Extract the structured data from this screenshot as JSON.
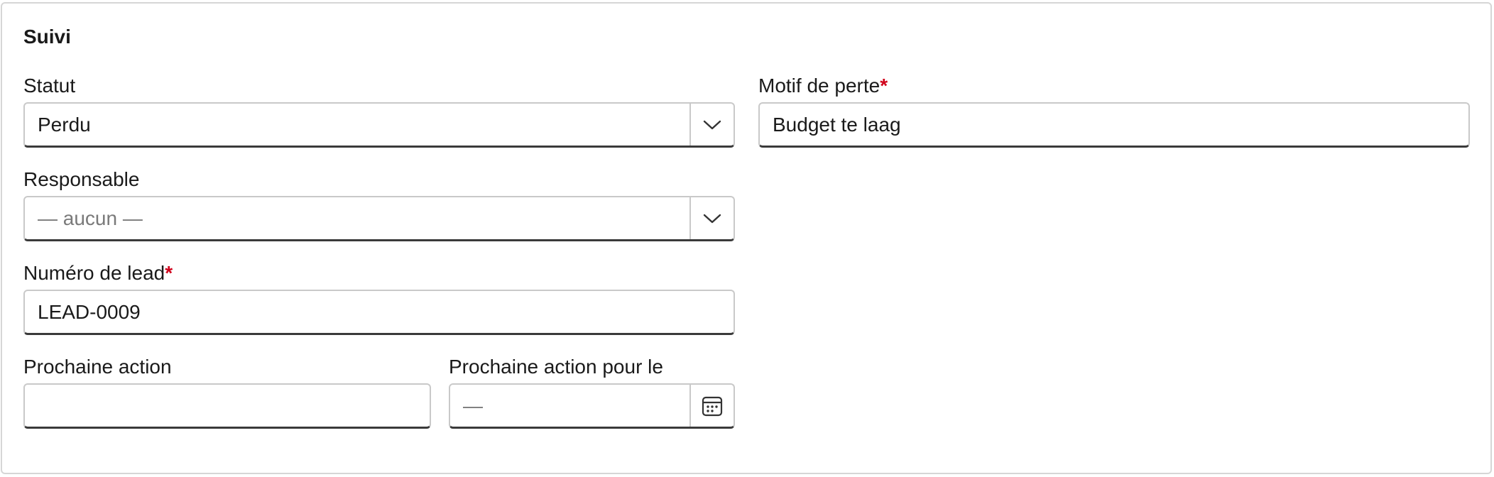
{
  "section": {
    "title": "Suivi"
  },
  "fields": {
    "statut": {
      "label": "Statut",
      "value": "Perdu",
      "icon": "chevron-down-icon"
    },
    "motif_de_perte": {
      "label": "Motif de perte",
      "required_mark": "*",
      "value": "Budget te laag"
    },
    "responsable": {
      "label": "Responsable",
      "placeholder": "— aucun —",
      "icon": "chevron-down-icon"
    },
    "numero_de_lead": {
      "label": "Numéro de lead",
      "required_mark": "*",
      "value": "LEAD-0009"
    },
    "prochaine_action": {
      "label": "Prochaine action",
      "value": ""
    },
    "prochaine_action_pour_le": {
      "label": "Prochaine action pour le",
      "placeholder": "—",
      "icon": "calendar-icon"
    }
  },
  "colors": {
    "required": "#d0021b",
    "border": "#c9c9c9",
    "border_bottom": "#3a3a3a",
    "placeholder": "#7a7a7a"
  }
}
